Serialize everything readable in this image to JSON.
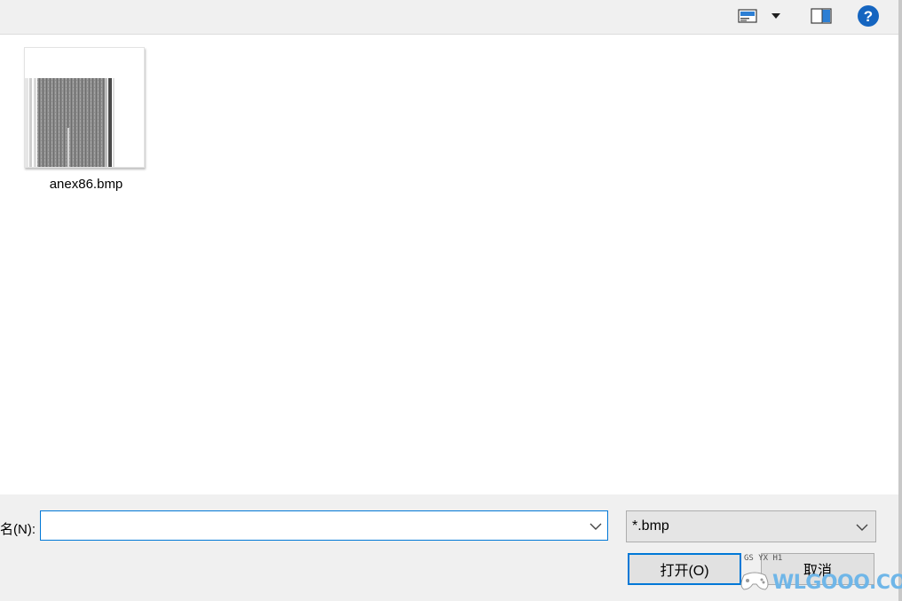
{
  "toolbar": {
    "view_icon": "view-options-icon",
    "dropdown_icon": "triangle-down-icon",
    "preview_icon": "preview-pane-icon",
    "help_icon": "help-icon",
    "help_glyph": "?"
  },
  "files": [
    {
      "name": "anex86.bmp",
      "thumbnail": "scanned-document-thumbnail"
    }
  ],
  "bottom": {
    "filename_label": "名(N):",
    "filename_value": "",
    "filetype_value": "*.bmp",
    "open_label": "打开(O)",
    "cancel_label": "取消"
  },
  "watermark": {
    "text": "WLGOOO.COM",
    "small": "GS YX H1"
  },
  "colors": {
    "accent": "#0078d7",
    "toolbar_bg": "#f0f0f0",
    "help_blue": "#1565c0"
  }
}
